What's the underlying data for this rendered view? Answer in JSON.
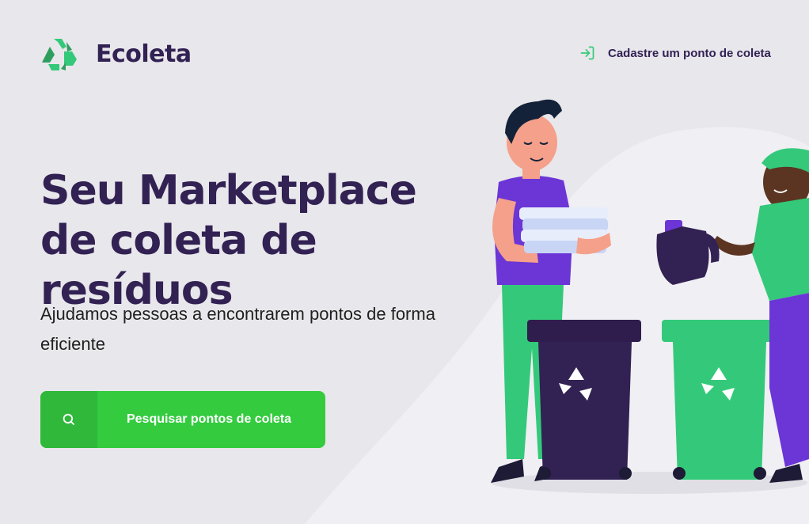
{
  "header": {
    "logo_text": "Ecoleta",
    "signup_link_label": "Cadastre um ponto de coleta"
  },
  "hero": {
    "title": "Seu Marketplace de coleta de resíduos",
    "description": "Ajudamos pessoas a encontrarem pontos de forma eficiente",
    "search_button_label": "Pesquisar pontos de coleta"
  },
  "icons": {
    "logo": "recycle-icon",
    "signup": "log-in-icon",
    "search": "search-icon"
  },
  "colors": {
    "background": "#E8E7EB",
    "primary_text": "#322153",
    "accent": "#34CB3F",
    "accent_dark": "#2FB83A",
    "brand_green": "#34C97A"
  }
}
